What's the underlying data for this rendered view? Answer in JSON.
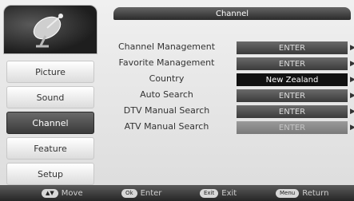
{
  "header": {
    "title": "Channel"
  },
  "sidebar": {
    "items": [
      {
        "label": "Picture"
      },
      {
        "label": "Sound"
      },
      {
        "label": "Channel"
      },
      {
        "label": "Feature"
      },
      {
        "label": "Setup"
      }
    ],
    "active_index": 2
  },
  "menu": {
    "rows": [
      {
        "label": "Channel Management",
        "value": "ENTER"
      },
      {
        "label": "Favorite Management",
        "value": "ENTER"
      },
      {
        "label": "Country",
        "value": "New Zealand"
      },
      {
        "label": "Auto Search",
        "value": "ENTER"
      },
      {
        "label": "DTV Manual Search",
        "value": "ENTER"
      },
      {
        "label": "ATV Manual Search",
        "value": "ENTER"
      }
    ]
  },
  "footer": {
    "hints": [
      {
        "key": "▲▼",
        "label": "Move"
      },
      {
        "key": "Ok",
        "label": "Enter"
      },
      {
        "key": "Exit",
        "label": "Exit"
      },
      {
        "key": "Menu",
        "label": "Return"
      }
    ]
  },
  "colors": {
    "active_nav": "#4a4a4a",
    "value_box": "#4a4a4a",
    "country_box": "#111111"
  },
  "icons": {
    "logo": "satellite-dish-icon",
    "row_arrow": "right-arrow-icon"
  }
}
